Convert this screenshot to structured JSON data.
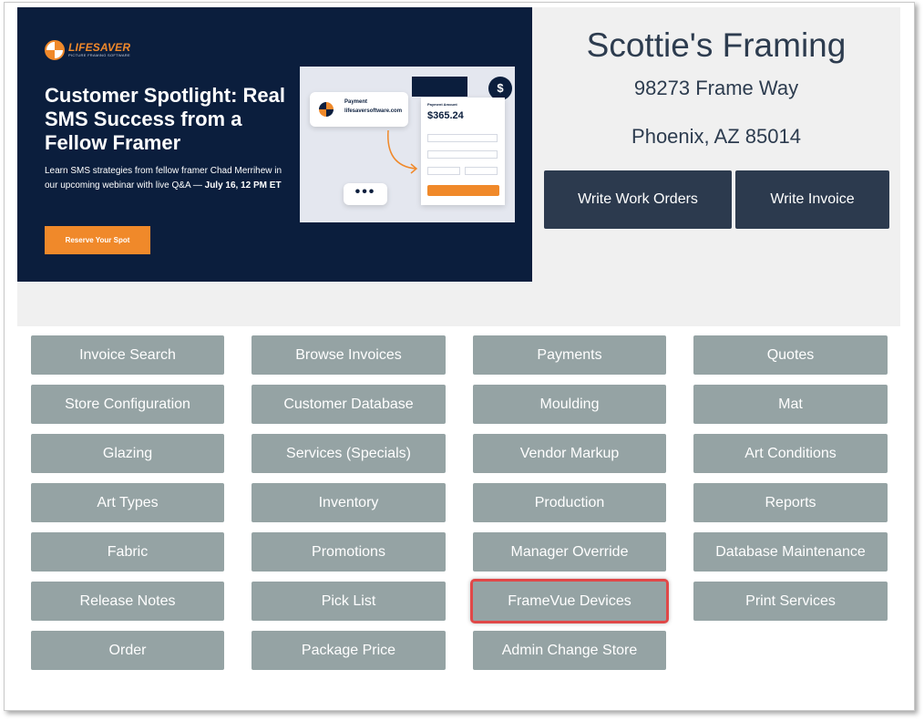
{
  "banner": {
    "logo_text": "LIFESAVER",
    "logo_subtext": "PICTURE FRAMING SOFTWARE",
    "headline": "Customer Spotlight: Real SMS Success from a Fellow Framer",
    "body": "Learn SMS strategies from fellow framer Chad Merrihew in our upcoming webinar with live Q&A —",
    "date": "July 16, 12 PM ET",
    "cta_label": "Reserve Your Spot",
    "mockup": {
      "payment_label": "Payment",
      "payment_site": "lifesaversoftware.com",
      "amount_label": "Payment Amount",
      "amount": "$365.24",
      "dollar_symbol": "$",
      "dots": "•••"
    },
    "colors": {
      "background": "#0b1e3d",
      "accent": "#f0892a"
    }
  },
  "store": {
    "name": "Scottie's Framing",
    "street": "98273 Frame Way",
    "city_state_zip": "Phoenix, AZ 85014"
  },
  "actions": {
    "write_work_orders": "Write Work Orders",
    "write_invoice": "Write Invoice"
  },
  "menu": [
    "Invoice Search",
    "Browse Invoices",
    "Payments",
    "Quotes",
    "Store Configuration",
    "Customer Database",
    "Moulding",
    "Mat",
    "Glazing",
    "Services (Specials)",
    "Vendor Markup",
    "Art Conditions",
    "Art Types",
    "Inventory",
    "Production",
    "Reports",
    "Fabric",
    "Promotions",
    "Manager Override",
    "Database Maintenance",
    "Release Notes",
    "Pick List",
    "FrameVue Devices",
    "Print Services",
    "Order",
    "Package Price",
    "Admin Change Store"
  ],
  "highlighted_item": "FrameVue Devices",
  "colors": {
    "menu_button": "#95a3a4",
    "action_button": "#2c3a4e",
    "highlight_outline": "#e04848",
    "panel_background": "#f0f0f0"
  }
}
